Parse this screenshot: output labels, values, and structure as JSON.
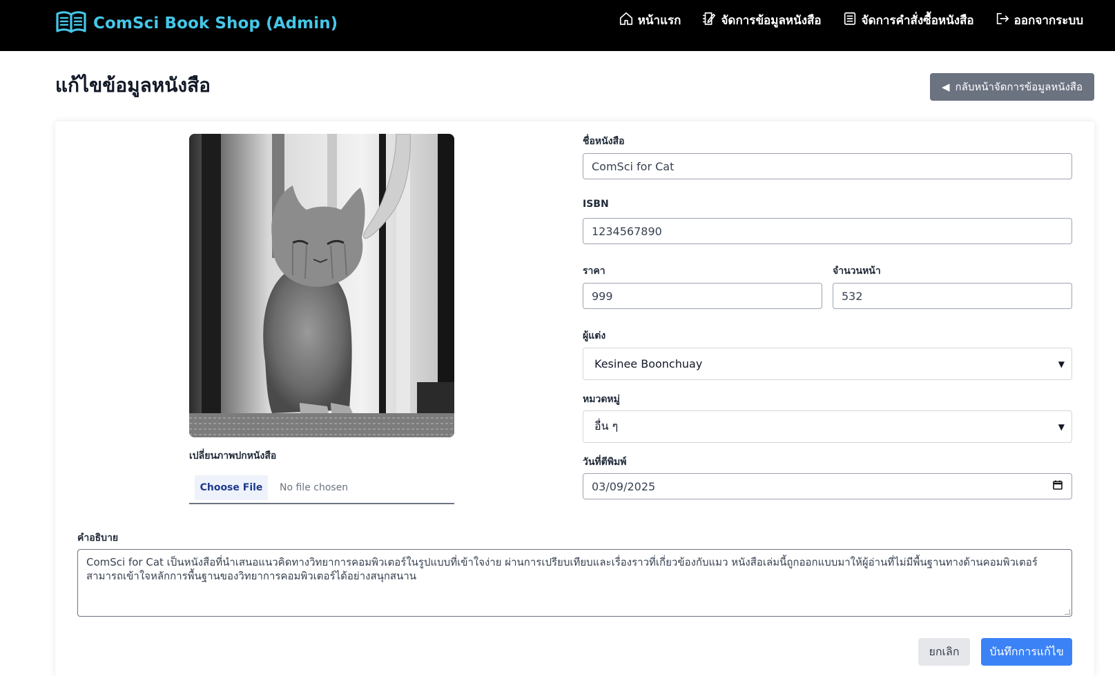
{
  "header": {
    "brand": "ComSci Book Shop (Admin)",
    "nav": [
      {
        "label": "หน้าแรก",
        "icon": "home-icon"
      },
      {
        "label": "จัดการข้อมูลหนังสือ",
        "icon": "edit-notebook-icon"
      },
      {
        "label": "จัดการคำสั่งซื้อหนังสือ",
        "icon": "list-document-icon"
      },
      {
        "label": "ออกจากระบบ",
        "icon": "logout-icon"
      }
    ]
  },
  "page": {
    "title": "แก้ไขข้อมูลหนังสือ",
    "back_button": "กลับหน้าจัดการข้อมูลหนังสือ"
  },
  "form": {
    "cover_label": "เปลี่ยนภาพปกหนังสือ",
    "file_button": "Choose File",
    "file_status": "No file chosen",
    "name_label": "ชื่อหนังสือ",
    "name_value": "ComSci for Cat",
    "isbn_label": "ISBN",
    "isbn_value": "1234567890",
    "price_label": "ราคา",
    "price_value": "999",
    "pages_label": "จำนวนหน้า",
    "pages_value": "532",
    "author_label": "ผู้แต่ง",
    "author_value": "Kesinee Boonchuay",
    "category_label": "หมวดหมู่",
    "category_value": "อื่น ๆ",
    "date_label": "วันที่ตีพิมพ์",
    "date_value": "03/09/2025",
    "description_label": "คำอธิบาย",
    "description_value": "ComSci for Cat เป็นหนังสือที่นำเสนอแนวคิดทางวิทยาการคอมพิวเตอร์ในรูปแบบที่เข้าใจง่าย ผ่านการเปรียบเทียบและเรื่องราวที่เกี่ยวข้องกับแมว หนังสือเล่มนี้ถูกออกแบบมาให้ผู้อ่านที่ไม่มีพื้นฐานทางด้านคอมพิวเตอร์สามารถเข้าใจหลักการพื้นฐานของวิทยาการคอมพิวเตอร์ได้อย่างสนุกสนาน",
    "cancel_button": "ยกเลิก",
    "save_button": "บันทึกการแก้ไข"
  },
  "colors": {
    "navbar": "#000000",
    "brand": "#45c7e8",
    "back_button": "#6b7280",
    "save_button": "#3b82f6",
    "cancel_button": "#e5e7eb"
  }
}
